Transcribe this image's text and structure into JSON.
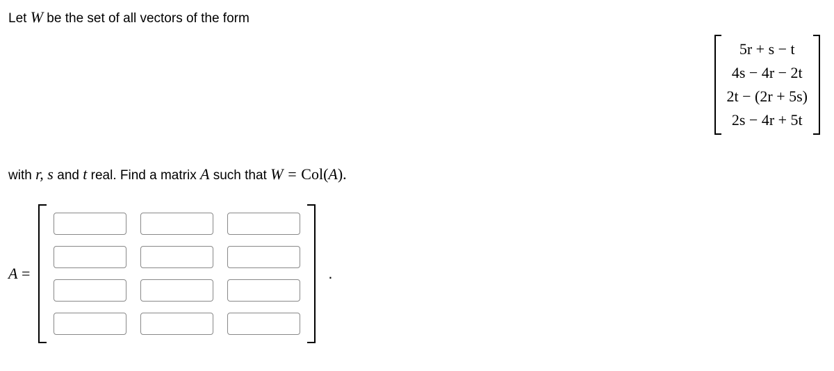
{
  "problem": {
    "line1_pre": "Let ",
    "line1_W": "W",
    "line1_post": " be the set of all vectors of the form",
    "line2_pre": "with ",
    "line2_vars": "r, s ",
    "line2_and": "and ",
    "line2_t": "t",
    "line2_mid": " real. Find a matrix ",
    "line2_A": "A",
    "line2_such": " such that ",
    "line2_Weq": "W = ",
    "line2_col": "Col(",
    "line2_A2": "A",
    "line2_close": ").",
    "vector": {
      "row1": "5r + s − t",
      "row2": "4s − 4r − 2t",
      "row3": "2t − (2r + 5s)",
      "row4": "2s − 4r + 5t"
    },
    "answer_label_A": "A",
    "answer_label_eq": " = ",
    "period": "."
  }
}
